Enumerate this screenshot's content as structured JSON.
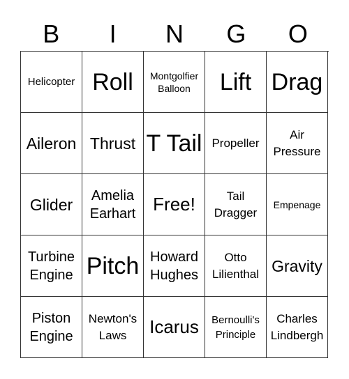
{
  "header": [
    "B",
    "I",
    "N",
    "G",
    "O"
  ],
  "cells": [
    {
      "text": "Helicopter",
      "size": "s-xs"
    },
    {
      "text": "Roll",
      "size": "s-xl"
    },
    {
      "text": "Montgolfier Balloon",
      "size": "s-xxs"
    },
    {
      "text": "Lift",
      "size": "s-xl"
    },
    {
      "text": "Drag",
      "size": "s-xl"
    },
    {
      "text": "Aileron",
      "size": "s-ml"
    },
    {
      "text": "Thrust",
      "size": "s-ml"
    },
    {
      "text": "T Tail",
      "size": "s-xl"
    },
    {
      "text": "Propeller",
      "size": "s-s"
    },
    {
      "text": "Air Pressure",
      "size": "s-s"
    },
    {
      "text": "Glider",
      "size": "s-ml"
    },
    {
      "text": "Amelia Earhart",
      "size": "s-m"
    },
    {
      "text": "Free!",
      "size": "s-l"
    },
    {
      "text": "Tail Dragger",
      "size": "s-s"
    },
    {
      "text": "Empenage",
      "size": "s-xxs"
    },
    {
      "text": "Turbine Engine",
      "size": "s-m"
    },
    {
      "text": "Pitch",
      "size": "s-xl"
    },
    {
      "text": "Howard Hughes",
      "size": "s-m"
    },
    {
      "text": "Otto Lilienthal",
      "size": "s-s"
    },
    {
      "text": "Gravity",
      "size": "s-ml"
    },
    {
      "text": "Piston Engine",
      "size": "s-m"
    },
    {
      "text": "Newton's Laws",
      "size": "s-s"
    },
    {
      "text": "Icarus",
      "size": "s-l"
    },
    {
      "text": "Bernoulli's Principle",
      "size": "s-xs"
    },
    {
      "text": "Charles Lindbergh",
      "size": "s-s"
    }
  ]
}
